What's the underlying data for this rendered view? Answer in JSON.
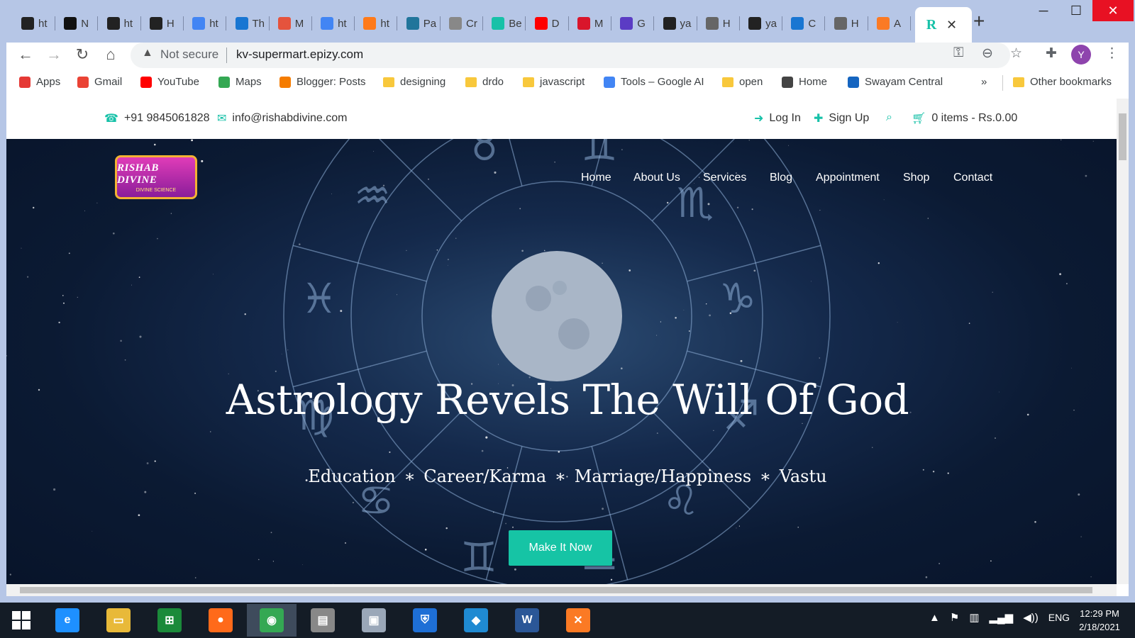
{
  "window": {
    "tabs": [
      {
        "label": "ht",
        "icon": "codepen-like-icon",
        "color": "#222222"
      },
      {
        "label": "N",
        "icon": "hackerrank-icon",
        "color": "#111111"
      },
      {
        "label": "ht",
        "icon": "codepen-like-icon",
        "color": "#222222"
      },
      {
        "label": "H",
        "icon": "github-icon",
        "color": "#222222"
      },
      {
        "label": "ht",
        "icon": "google-icon",
        "color": "#4285f4"
      },
      {
        "label": "Th",
        "icon": "code-icon",
        "color": "#1976d2"
      },
      {
        "label": "M",
        "icon": "colorful-icon",
        "color": "#e5533d"
      },
      {
        "label": "ht",
        "icon": "google-icon",
        "color": "#4285f4"
      },
      {
        "label": "ht",
        "icon": "link-icon",
        "color": "#ff7a1a"
      },
      {
        "label": "Pa",
        "icon": "wordpress-icon",
        "color": "#21759b"
      },
      {
        "label": "Cr",
        "icon": "loading-icon",
        "color": "#888888"
      },
      {
        "label": "Be",
        "icon": "r-icon",
        "color": "#17c1a8"
      },
      {
        "label": "D",
        "icon": "youtube-icon",
        "color": "#ff0000"
      },
      {
        "label": "M",
        "icon": "m-icon",
        "color": "#d9152b"
      },
      {
        "label": "G",
        "icon": "bolt-icon",
        "color": "#5b3cc4"
      },
      {
        "label": "ya",
        "icon": "github-icon",
        "color": "#222222"
      },
      {
        "label": "H",
        "icon": "globe-icon",
        "color": "#666666"
      },
      {
        "label": "ya",
        "icon": "github-icon",
        "color": "#222222"
      },
      {
        "label": "C",
        "icon": "code-icon",
        "color": "#1976d2"
      },
      {
        "label": "H",
        "icon": "globe-icon",
        "color": "#666666"
      },
      {
        "label": "A",
        "icon": "xampp-icon",
        "color": "#fb7a24"
      }
    ],
    "active_tab": {
      "icon": "r-icon",
      "glyph": "R"
    },
    "buttons": {
      "minimize": "─",
      "maximize": "☐",
      "close": "✕",
      "new_tab": "+"
    }
  },
  "toolbar": {
    "back": "←",
    "forward": "→",
    "reload": "↻",
    "home": "⌂",
    "security_warning": "▲",
    "not_secure": "Not secure",
    "url": "kv-supermart.epizy.com",
    "key_icon": "⚿",
    "zoom_icon": "⊖",
    "star_icon": "☆",
    "extensions_icon": "✚",
    "menu_icon": "⋮",
    "avatar": "Y"
  },
  "bookmarks": [
    {
      "label": "Apps",
      "icon": "apps-grid-icon"
    },
    {
      "label": "Gmail",
      "icon": "gmail-icon"
    },
    {
      "label": "YouTube",
      "icon": "youtube-icon"
    },
    {
      "label": "Maps",
      "icon": "maps-pin-icon"
    },
    {
      "label": "Blogger: Posts",
      "icon": "blogger-icon"
    },
    {
      "label": "designing",
      "icon": "folder-icon"
    },
    {
      "label": "drdo",
      "icon": "folder-icon"
    },
    {
      "label": "javascript",
      "icon": "folder-icon"
    },
    {
      "label": "Tools – Google AI",
      "icon": "dots-icon"
    },
    {
      "label": "open",
      "icon": "folder-icon"
    },
    {
      "label": "Home",
      "icon": "globe-icon"
    },
    {
      "label": "Swayam Central",
      "icon": "swayam-icon"
    }
  ],
  "bookmarks_overflow": "»",
  "other_bookmarks": "Other bookmarks",
  "site": {
    "phone": "+91 9845061828",
    "email": "info@rishabdivine.com",
    "login": "Log In",
    "signup": "Sign Up",
    "cart": "0 items - Rs.0.00",
    "logo_title": "RISHAB DIVINE",
    "logo_sub": "DIVINE SCIENCE",
    "nav": [
      "Home",
      "About Us",
      "Services",
      "Blog",
      "Appointment",
      "Shop",
      "Contact"
    ],
    "hero_title": "Astrology Revels The Will Of God",
    "hero_sub": "Education  ∗  Career/Karma  ∗  Marriage/Happiness  ∗  Vastu",
    "cta": "Make It Now",
    "accent": "#17c1a8"
  },
  "taskbar": {
    "apps": [
      {
        "name": "ie-icon",
        "glyph": "e",
        "color": "#1e90ff"
      },
      {
        "name": "file-explorer-icon",
        "glyph": "▭",
        "color": "#e8b939"
      },
      {
        "name": "store-icon",
        "glyph": "⊞",
        "color": "#1b8a3a"
      },
      {
        "name": "firefox-icon",
        "glyph": "●",
        "color": "#ff6a1a"
      },
      {
        "name": "chrome-icon",
        "glyph": "◉",
        "color": "#34a853"
      },
      {
        "name": "printer-icon",
        "glyph": "▤",
        "color": "#888888"
      },
      {
        "name": "monitor-icon",
        "glyph": "▣",
        "color": "#9aa7b8"
      },
      {
        "name": "defender-icon",
        "glyph": "⛨",
        "color": "#1e6fd6"
      },
      {
        "name": "vscode-icon",
        "glyph": "◆",
        "color": "#1f8ad2"
      },
      {
        "name": "word-icon",
        "glyph": "W",
        "color": "#2b5797"
      },
      {
        "name": "xampp-icon",
        "glyph": "✕",
        "color": "#fb7a24"
      }
    ],
    "tray": [
      "▲",
      "⚑",
      "▥",
      "▂▄▆",
      "◀))"
    ],
    "lang": "ENG",
    "time": "12:29 PM",
    "date": "2/18/2021"
  }
}
